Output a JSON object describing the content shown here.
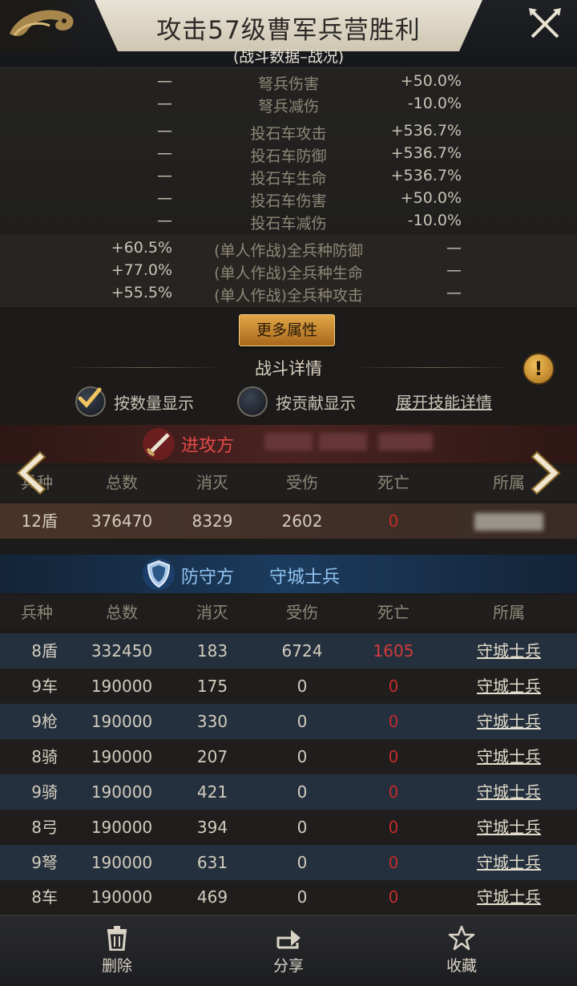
{
  "header": {
    "title": "攻击57级曹军兵营胜利",
    "subtitle": "(战斗数据–战况)"
  },
  "stats": [
    {
      "left": "—",
      "name": "弩兵伤害",
      "right": "+50.0%"
    },
    {
      "left": "—",
      "name": "弩兵减伤",
      "right": "-10.0%"
    },
    {
      "left": "—",
      "name": "投石车攻击",
      "right": "+536.7%"
    },
    {
      "left": "—",
      "name": "投石车防御",
      "right": "+536.7%"
    },
    {
      "left": "—",
      "name": "投石车生命",
      "right": "+536.7%"
    },
    {
      "left": "—",
      "name": "投石车伤害",
      "right": "+50.0%"
    },
    {
      "left": "—",
      "name": "投石车减伤",
      "right": "-10.0%"
    },
    {
      "left": "+60.5%",
      "name": "(单人作战)全兵种防御",
      "right": "—"
    },
    {
      "left": "+77.0%",
      "name": "(单人作战)全兵种生命",
      "right": "—"
    },
    {
      "left": "+55.5%",
      "name": "(单人作战)全兵种攻击",
      "right": "—"
    }
  ],
  "more_button": "更多属性",
  "section_title": "战斗详情",
  "options": {
    "by_quantity": "按数量显示",
    "by_contribution": "按贡献显示",
    "expand_skills": "展开技能详情"
  },
  "columns": [
    "兵种",
    "总数",
    "消灭",
    "受伤",
    "死亡",
    "所属"
  ],
  "attacker": {
    "label": "进攻方",
    "rows": [
      {
        "type": "12盾",
        "total": "376470",
        "kill": "8329",
        "hurt": "2602",
        "dead": "0"
      }
    ]
  },
  "defender": {
    "label": "防守方",
    "name": "守城士兵",
    "rows": [
      {
        "type": "8盾",
        "total": "332450",
        "kill": "183",
        "hurt": "6724",
        "dead": "1605",
        "owner": "守城士兵"
      },
      {
        "type": "9车",
        "total": "190000",
        "kill": "175",
        "hurt": "0",
        "dead": "0",
        "owner": "守城士兵"
      },
      {
        "type": "9枪",
        "total": "190000",
        "kill": "330",
        "hurt": "0",
        "dead": "0",
        "owner": "守城士兵"
      },
      {
        "type": "8骑",
        "total": "190000",
        "kill": "207",
        "hurt": "0",
        "dead": "0",
        "owner": "守城士兵"
      },
      {
        "type": "9骑",
        "total": "190000",
        "kill": "421",
        "hurt": "0",
        "dead": "0",
        "owner": "守城士兵"
      },
      {
        "type": "8弓",
        "total": "190000",
        "kill": "394",
        "hurt": "0",
        "dead": "0",
        "owner": "守城士兵"
      },
      {
        "type": "9弩",
        "total": "190000",
        "kill": "631",
        "hurt": "0",
        "dead": "0",
        "owner": "守城士兵"
      },
      {
        "type": "8车",
        "total": "190000",
        "kill": "469",
        "hurt": "0",
        "dead": "0",
        "owner": "守城士兵"
      }
    ]
  },
  "bottom_bar": {
    "delete": "删除",
    "share": "分享",
    "favorite": "收藏"
  },
  "colors": {
    "accent_gold": "#d9a24a",
    "attacker_red": "#e24a4a",
    "defender_blue": "#8fc3f0",
    "death_red": "#c22b2b"
  }
}
